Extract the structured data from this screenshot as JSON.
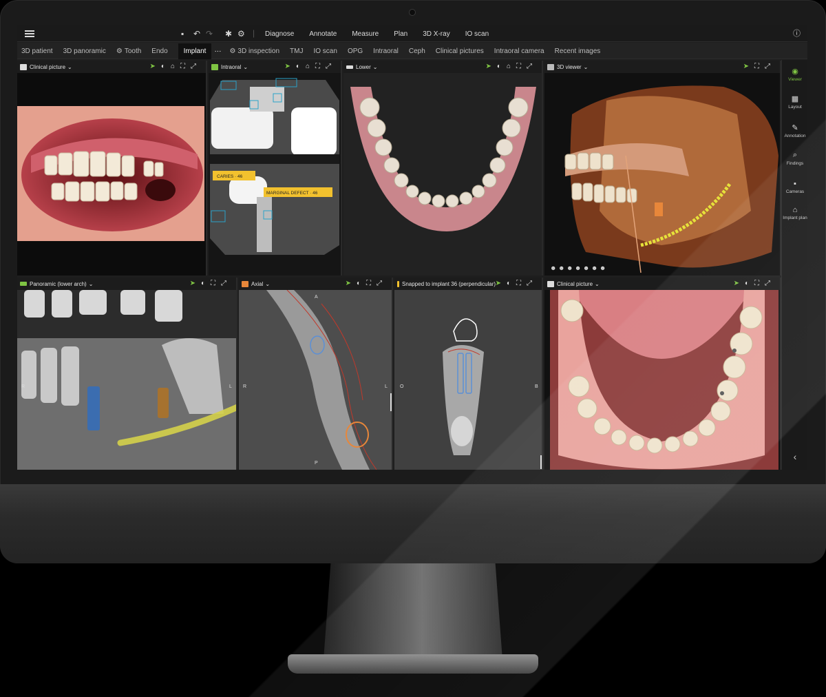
{
  "toolbar": {
    "menu_icon": "hamburger-icon",
    "mode_items": [
      "Diagnose",
      "Annotate",
      "Measure",
      "Plan",
      "3D X-ray",
      "IO scan"
    ],
    "help_icon": "help-icon"
  },
  "modebar": {
    "tabs_left": [
      "3D patient",
      "3D panoramic",
      "Tooth",
      "Endo"
    ],
    "active_tab": "Implant",
    "more": "···",
    "tabs_right": [
      "3D inspection",
      "TMJ",
      "IO scan",
      "OPG",
      "Intraoral",
      "Ceph",
      "Clinical pictures",
      "Intraoral camera",
      "Recent images"
    ]
  },
  "panels": {
    "clinical_top": {
      "title": "Clinical picture"
    },
    "intraoral": {
      "title": "Intraoral",
      "annotations": [
        "CARIES · 46",
        "MARGINAL DEFECT · 46"
      ]
    },
    "lower": {
      "title": "Lower"
    },
    "viewer3d": {
      "title": "3D viewer"
    },
    "panoramic": {
      "title": "Panoramic (lower arch)",
      "left_marker": "R",
      "right_marker": "L"
    },
    "axial": {
      "title": "Axial",
      "top_marker": "A",
      "bottom_marker": "P",
      "left_marker": "R",
      "right_marker": "L"
    },
    "snapped": {
      "title": "Snapped to implant 36 (perpendicular)",
      "left_marker": "O",
      "right_marker": "B"
    },
    "clinical_bottom": {
      "title": "Clinical picture"
    }
  },
  "sidebar": {
    "items": [
      {
        "label": "Viewer",
        "icon": "eye-icon",
        "active": true
      },
      {
        "label": "Layout",
        "icon": "layout-icon"
      },
      {
        "label": "Annotation",
        "icon": "pen-icon"
      },
      {
        "label": "Findings",
        "icon": "findings-icon"
      },
      {
        "label": "Cameras",
        "icon": "camera-icon"
      },
      {
        "label": "Implant plan",
        "icon": "implant-icon"
      }
    ],
    "collapse_icon": "chevron-left-icon"
  },
  "colors": {
    "accent_green": "#7fc443",
    "annotation_yellow": "#f2c12e",
    "axial_orange": "#e8873a"
  }
}
